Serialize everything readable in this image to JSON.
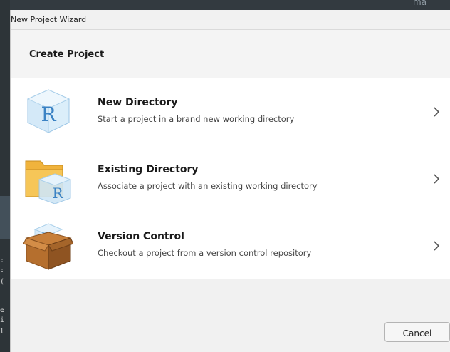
{
  "background": {
    "top_text": "ma",
    "code_lines": [
      ":",
      ":",
      "(",
      "e",
      "i",
      "l"
    ]
  },
  "dialog": {
    "window_title": "New Project Wizard",
    "header_title": "Create Project",
    "options": [
      {
        "title": "New Directory",
        "description": "Start a project in a brand new working directory",
        "icon": "r-cube-icon"
      },
      {
        "title": "Existing Directory",
        "description": "Associate a project with an existing working directory",
        "icon": "folder-r-icon"
      },
      {
        "title": "Version Control",
        "description": "Checkout a project from a version control repository",
        "icon": "box-r-icon"
      }
    ],
    "cancel_label": "Cancel"
  },
  "colors": {
    "icon_blue": "#3a82c4",
    "folder_yellow": "#f0b33c",
    "box_brown": "#a5652a"
  }
}
